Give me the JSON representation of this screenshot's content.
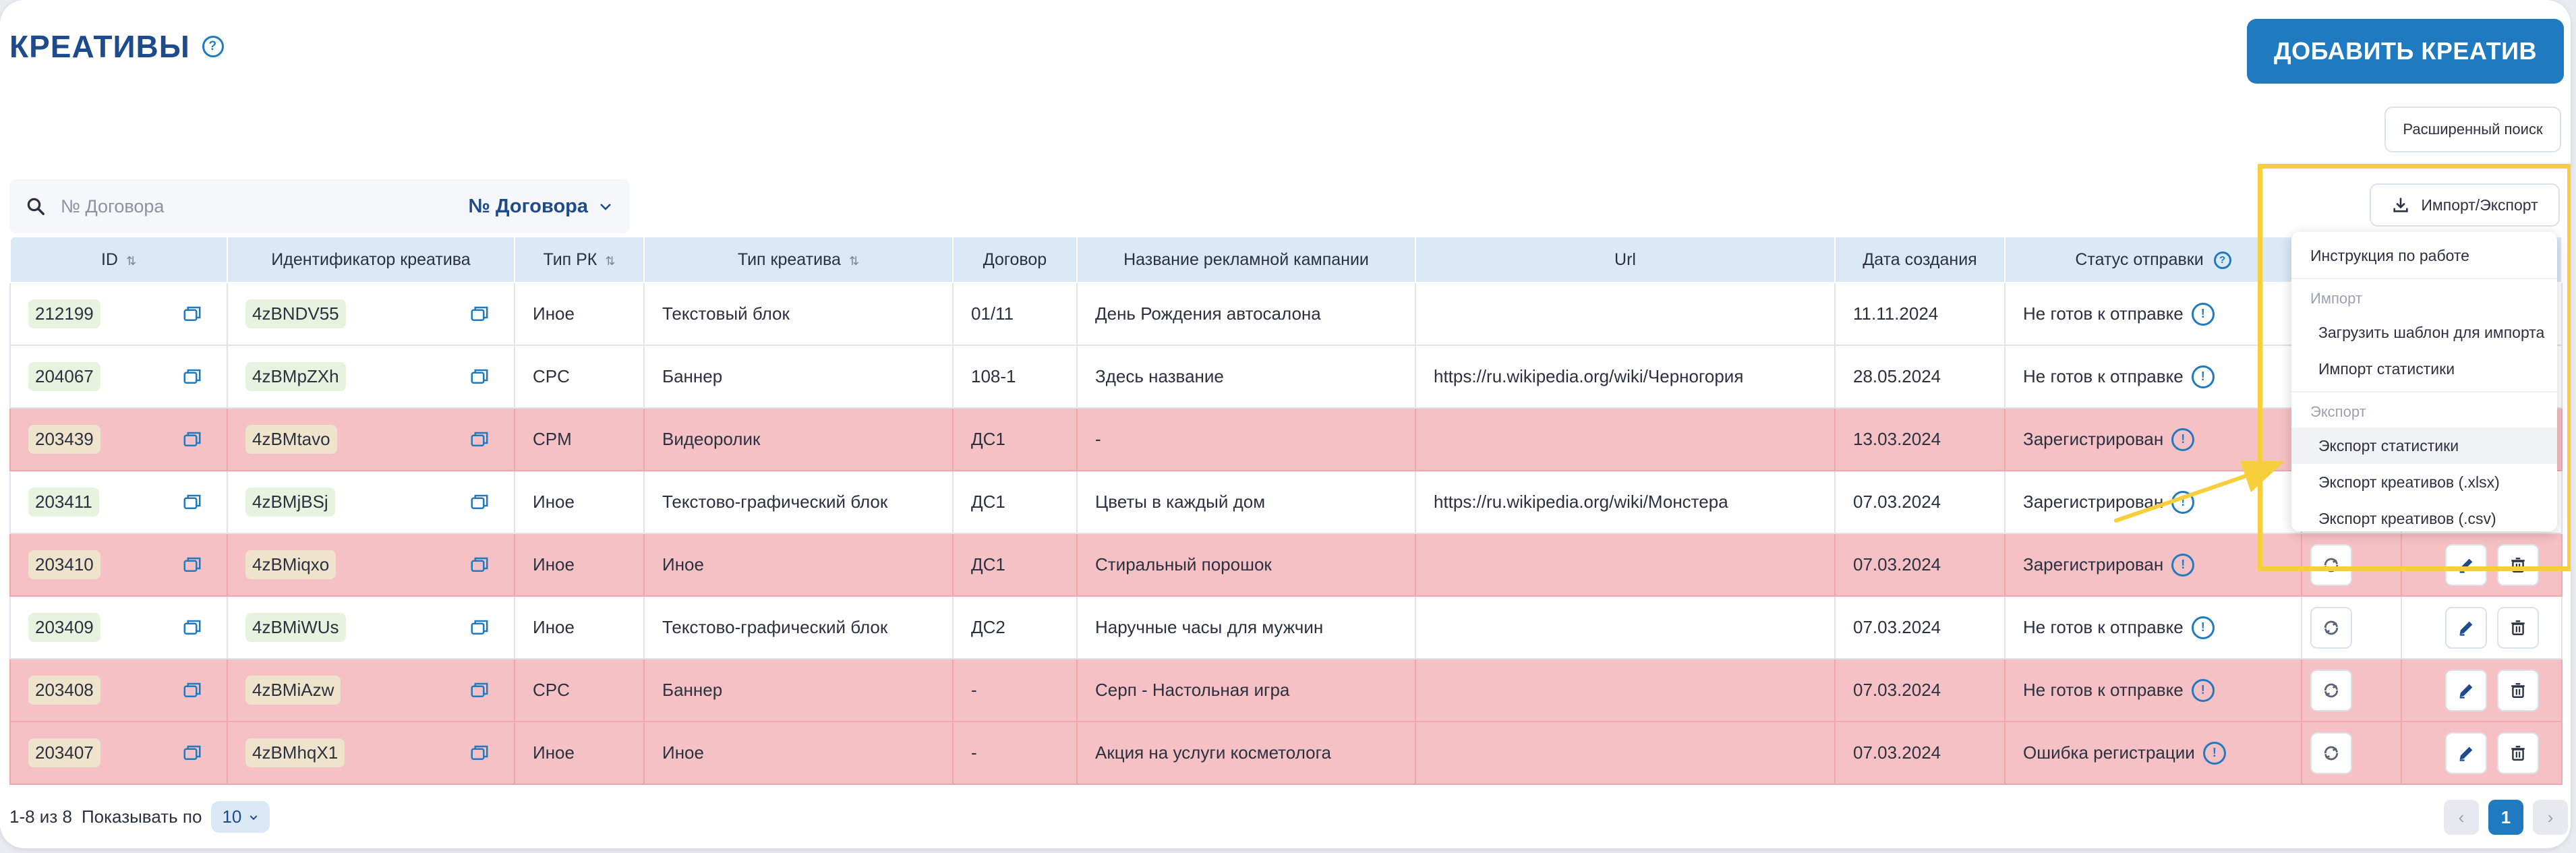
{
  "header": {
    "title": "КРЕАТИВЫ",
    "help_glyph": "?"
  },
  "buttons": {
    "add_creative": "ДОБАВИТЬ КРЕАТИВ",
    "advanced_search": "Расширенный поиск",
    "import_export": "Импорт/Экспорт"
  },
  "search": {
    "placeholder": "№ Договора",
    "filter_label": "№ Договора"
  },
  "table": {
    "columns": [
      "ID",
      "Идентификатор креатива",
      "Тип РК",
      "Тип креатива",
      "Договор",
      "Название рекламной кампании",
      "Url",
      "Дата создания",
      "Статус отправки"
    ],
    "rows": [
      {
        "id": "212199",
        "creative_id": "4zBNDV55",
        "rk_type": "Иное",
        "creative_type": "Текстовый блок",
        "contract": "01/11",
        "campaign": "День Рождения автосалона",
        "url": "",
        "date": "11.11.2024",
        "status": "Не готов к отправке"
      },
      {
        "id": "204067",
        "creative_id": "4zBMpZXh",
        "rk_type": "CPC",
        "creative_type": "Баннер",
        "contract": "108-1",
        "campaign": "Здесь название",
        "url": "https://ru.wikipedia.org/wiki/Черногория",
        "date": "28.05.2024",
        "status": "Не готов к отправке"
      },
      {
        "id": "203439",
        "creative_id": "4zBMtavo",
        "rk_type": "CPM",
        "creative_type": "Видеоролик",
        "contract": "ДС1",
        "campaign": "-",
        "url": "",
        "date": "13.03.2024",
        "status": "Зарегистрирован"
      },
      {
        "id": "203411",
        "creative_id": "4zBMjBSj",
        "rk_type": "Иное",
        "creative_type": "Текстово-графический блок",
        "contract": "ДС1",
        "campaign": "Цветы в каждый дом",
        "url": "https://ru.wikipedia.org/wiki/Монстера",
        "date": "07.03.2024",
        "status": "Зарегистрирован"
      },
      {
        "id": "203410",
        "creative_id": "4zBMiqxo",
        "rk_type": "Иное",
        "creative_type": "Иное",
        "contract": "ДС1",
        "campaign": "Стиральный порошок",
        "url": "",
        "date": "07.03.2024",
        "status": "Зарегистрирован"
      },
      {
        "id": "203409",
        "creative_id": "4zBMiWUs",
        "rk_type": "Иное",
        "creative_type": "Текстово-графический блок",
        "contract": "ДС2",
        "campaign": "Наручные часы для мужчин",
        "url": "",
        "date": "07.03.2024",
        "status": "Не готов к отправке"
      },
      {
        "id": "203408",
        "creative_id": "4zBMiAzw",
        "rk_type": "CPC",
        "creative_type": "Баннер",
        "contract": "-",
        "campaign": "Серп - Настольная игра",
        "url": "",
        "date": "07.03.2024",
        "status": "Не готов к отправке"
      },
      {
        "id": "203407",
        "creative_id": "4zBMhqX1",
        "rk_type": "Иное",
        "creative_type": "Иное",
        "contract": "-",
        "campaign": "Акция на услуги косметолога",
        "url": "",
        "date": "07.03.2024",
        "status": "Ошибка регистрации"
      }
    ]
  },
  "menu": {
    "instructions": "Инструкция по работе",
    "import_section": "Импорт",
    "upload_template": "Загрузить шаблон для импорта",
    "import_stats": "Импорт статистики",
    "export_section": "Экспорт",
    "export_stats": "Экспорт статистики",
    "export_xlsx": "Экспорт креативов (.xlsx)",
    "export_csv": "Экспорт креативов (.csv)"
  },
  "footer": {
    "range": "1-8 из 8",
    "show_label": "Показывать по",
    "per_page": "10",
    "current_page": "1",
    "prev": "‹",
    "next": "›"
  },
  "colors": {
    "accent": "#1f7ac0",
    "title": "#1e4b8c",
    "row_pink": "#f6c1c5",
    "header_bg": "#dbe9f6",
    "highlight": "#f7cf3c"
  },
  "row_styles": [
    "white",
    "white",
    "pink",
    "white",
    "pink",
    "white",
    "pink",
    "pink"
  ]
}
